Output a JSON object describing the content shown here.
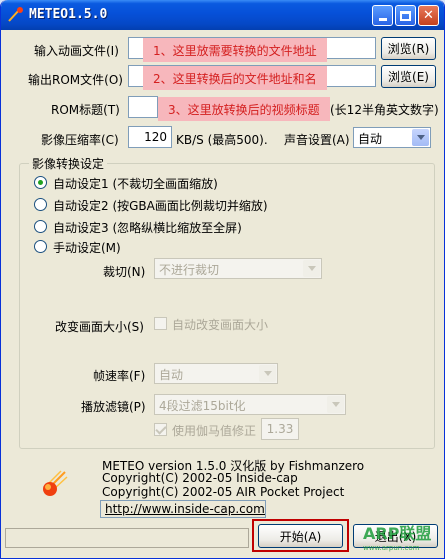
{
  "window": {
    "title": "METEO1.5.0"
  },
  "files": {
    "input_label": "输入动画文件(I)",
    "input_note": "1、这里放需要转换的文件地址",
    "input_browse": "浏览(R)",
    "output_label": "输出ROM文件(O)",
    "output_note": "2、这里转换后的文件地址和名",
    "output_browse": "浏览(E)",
    "rom_title_label": "ROM标题(T)",
    "rom_title_note": "3、这里放转换后的视频标题",
    "rom_title_hint": "(长12半角英文数字)"
  },
  "compression": {
    "label": "影像压缩率(C)",
    "value": "120",
    "unit": "KB/S (最高500)."
  },
  "audio": {
    "label": "声音设置(A)",
    "selected": "自动"
  },
  "settings": {
    "group_title": "影像转换设定",
    "options": [
      {
        "label": "自动设定1 (不裁切全画面缩放)",
        "selected": true
      },
      {
        "label": "自动设定2 (按GBA画面比例裁切并缩放)",
        "selected": false
      },
      {
        "label": "自动设定3 (忽略纵横比缩放至全屏)",
        "selected": false
      },
      {
        "label": "手动设定(M)",
        "selected": false
      }
    ],
    "crop_label": "裁切(N)",
    "crop_selected": "不进行裁切",
    "resize_label": "改变画面大小(S)",
    "resize_check_label": "自动改变画面大小",
    "framerate_label": "帧速率(F)",
    "framerate_selected": "自动",
    "filter_label": "播放滤镜(P)",
    "filter_selected": "4段过滤15bit化",
    "gamma_check_label": "使用伽马值修正",
    "gamma_value": "1.33"
  },
  "about": {
    "line1": "METEO version 1.5.0 汉化版 by Fishmanzero",
    "line2": "Copyright(C) 2002-05 Inside-cap",
    "line3": "Copyright(C) 2002-05 AIR Pocket Project",
    "url": "http://www.inside-cap.com/"
  },
  "actions": {
    "start": "开始(A)",
    "exit": "退出(X)"
  },
  "watermark": {
    "brand": "ARP联盟",
    "url": "www.arpun.com"
  },
  "colors": {
    "titlebar": "#0650d8",
    "note_bg": "#f7b7bc",
    "note_text": "#d42020",
    "highlight": "#c00000"
  }
}
